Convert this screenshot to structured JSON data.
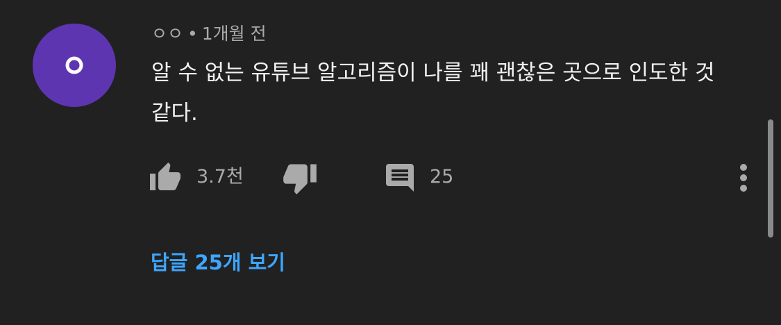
{
  "comment": {
    "author": "ㅇㅇ",
    "separator": "•",
    "time": "1개월 전",
    "text": "알 수 없는 유튜브 알고리즘이 나를 꽤 괜찮은 곳으로 인도한 것 같다.",
    "avatar_color": "#5e35b1"
  },
  "actions": {
    "like_count": "3.7천",
    "reply_count": "25",
    "like_icon": "thumb-up-icon",
    "dislike_icon": "thumb-down-icon",
    "reply_icon": "comment-icon",
    "more_icon": "more-vert-icon"
  },
  "replies": {
    "view_label": "답글 25개 보기",
    "link_color": "#3ea6ff"
  }
}
